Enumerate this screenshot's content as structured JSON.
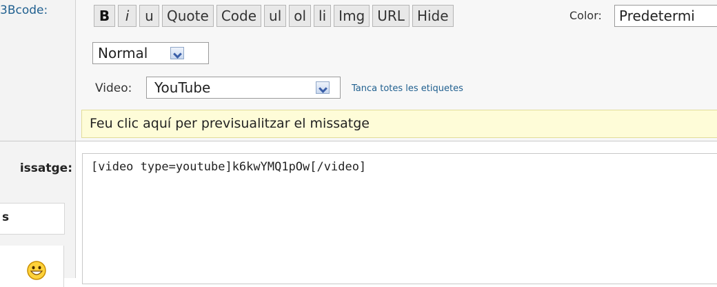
{
  "labels": {
    "bbcode": "3Bcode:",
    "message": "issatge:",
    "side_box": "s"
  },
  "toolbar": {
    "buttons": [
      "B",
      "i",
      "u",
      "Quote",
      "Code",
      "ul",
      "ol",
      "li",
      "Img",
      "URL",
      "Hide"
    ],
    "color_label": "Color:",
    "color_value": "Predetermi"
  },
  "size_select": {
    "value": "Normal"
  },
  "video": {
    "label": "Video:",
    "value": "YouTube",
    "close_tags_link": "Tanca totes les etiquetes"
  },
  "preview": {
    "text": "Feu clic aquí per previsualitzar el missatge"
  },
  "message": {
    "value": "[video type=youtube]k6kwYMQ1pOw[/video]"
  },
  "icons": {
    "smiley": "smiley-grin-icon",
    "dropdown": "chevron-down-icon"
  }
}
